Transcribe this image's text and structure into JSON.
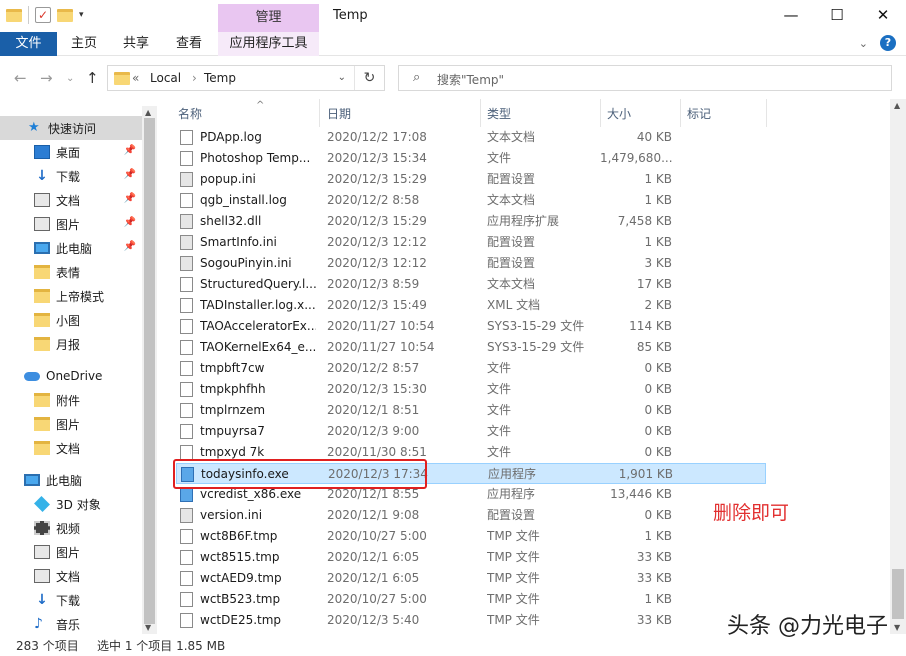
{
  "window": {
    "title": "Temp",
    "manage_tab": "管理",
    "controls": [
      "—",
      "☐",
      "✕"
    ]
  },
  "ribbon": {
    "tabs": [
      "文件",
      "主页",
      "共享",
      "查看",
      "应用程序工具"
    ]
  },
  "address": {
    "overflow": "«",
    "crumbs": [
      "Local",
      "Temp"
    ],
    "search_placeholder": "搜索\"Temp\""
  },
  "nav": {
    "items": [
      {
        "label": "快速访问",
        "icon": "star-icon"
      },
      {
        "label": "桌面",
        "icon": "desktop-icon"
      },
      {
        "label": "下载",
        "icon": "download-icon"
      },
      {
        "label": "文档",
        "icon": "document-icon"
      },
      {
        "label": "图片",
        "icon": "picture-icon"
      },
      {
        "label": "此电脑",
        "icon": "computer-icon"
      },
      {
        "label": "表情",
        "icon": "folder-icon"
      },
      {
        "label": "上帝模式",
        "icon": "folder-icon"
      },
      {
        "label": "小图",
        "icon": "folder-icon"
      },
      {
        "label": "月报",
        "icon": "folder-icon"
      },
      {
        "label": "OneDrive",
        "icon": "cloud-icon"
      },
      {
        "label": "附件",
        "icon": "folder-icon"
      },
      {
        "label": "图片",
        "icon": "folder-icon"
      },
      {
        "label": "文档",
        "icon": "folder-icon"
      },
      {
        "label": "此电脑",
        "icon": "computer-icon"
      },
      {
        "label": "3D 对象",
        "icon": "cube-icon"
      },
      {
        "label": "视频",
        "icon": "video-icon"
      },
      {
        "label": "图片",
        "icon": "picture-icon"
      },
      {
        "label": "文档",
        "icon": "document-icon"
      },
      {
        "label": "下载",
        "icon": "download-icon"
      },
      {
        "label": "音乐",
        "icon": "music-icon"
      }
    ]
  },
  "columns": [
    "名称",
    "日期",
    "类型",
    "大小",
    "标记"
  ],
  "files": [
    {
      "name": "PDApp.log",
      "date": "2020/12/2 17:08",
      "type": "文本文档",
      "size": "40 KB",
      "icon": "text-file-icon"
    },
    {
      "name": "Photoshop Temp...",
      "date": "2020/12/3 15:34",
      "type": "文件",
      "size": "1,479,680...",
      "icon": "file-icon"
    },
    {
      "name": "popup.ini",
      "date": "2020/12/3 15:29",
      "type": "配置设置",
      "size": "1 KB",
      "icon": "settings-file-icon"
    },
    {
      "name": "qgb_install.log",
      "date": "2020/12/2 8:58",
      "type": "文本文档",
      "size": "1 KB",
      "icon": "text-file-icon"
    },
    {
      "name": "shell32.dll",
      "date": "2020/12/3 15:29",
      "type": "应用程序扩展",
      "size": "7,458 KB",
      "icon": "dll-file-icon"
    },
    {
      "name": "SmartInfo.ini",
      "date": "2020/12/3 12:12",
      "type": "配置设置",
      "size": "1 KB",
      "icon": "settings-file-icon"
    },
    {
      "name": "SogouPinyin.ini",
      "date": "2020/12/3 12:12",
      "type": "配置设置",
      "size": "3 KB",
      "icon": "settings-file-icon"
    },
    {
      "name": "StructuredQuery.l...",
      "date": "2020/12/3 8:59",
      "type": "文本文档",
      "size": "17 KB",
      "icon": "text-file-icon"
    },
    {
      "name": "TADInstaller.log.x...",
      "date": "2020/12/3 15:49",
      "type": "XML 文档",
      "size": "2 KB",
      "icon": "xml-file-icon"
    },
    {
      "name": "TAOAcceleratorEx...",
      "date": "2020/11/27 10:54",
      "type": "SYS3-15-29 文件",
      "size": "114 KB",
      "icon": "file-icon"
    },
    {
      "name": "TAOKernelEx64_e...",
      "date": "2020/11/27 10:54",
      "type": "SYS3-15-29 文件",
      "size": "85 KB",
      "icon": "file-icon"
    },
    {
      "name": "tmpbft7cw",
      "date": "2020/12/2 8:57",
      "type": "文件",
      "size": "0 KB",
      "icon": "file-icon"
    },
    {
      "name": "tmpkphfhh",
      "date": "2020/12/3 15:30",
      "type": "文件",
      "size": "0 KB",
      "icon": "file-icon"
    },
    {
      "name": "tmplrnzem",
      "date": "2020/12/1 8:51",
      "type": "文件",
      "size": "0 KB",
      "icon": "file-icon"
    },
    {
      "name": "tmpuyrsa7",
      "date": "2020/12/3 9:00",
      "type": "文件",
      "size": "0 KB",
      "icon": "file-icon"
    },
    {
      "name": "tmpxyd 7k",
      "date": "2020/11/30 8:51",
      "type": "文件",
      "size": "0 KB",
      "icon": "file-icon"
    },
    {
      "name": "todaysinfo.exe",
      "date": "2020/12/3 17:34",
      "type": "应用程序",
      "size": "1,901 KB",
      "icon": "exe-file-icon",
      "selected": true
    },
    {
      "name": "vcredist_x86.exe",
      "date": "2020/12/1 8:55",
      "type": "应用程序",
      "size": "13,446 KB",
      "icon": "installer-icon"
    },
    {
      "name": "version.ini",
      "date": "2020/12/1 9:08",
      "type": "配置设置",
      "size": "0 KB",
      "icon": "settings-file-icon"
    },
    {
      "name": "wct8B6F.tmp",
      "date": "2020/10/27 5:00",
      "type": "TMP 文件",
      "size": "1 KB",
      "icon": "file-icon"
    },
    {
      "name": "wct8515.tmp",
      "date": "2020/12/1 6:05",
      "type": "TMP 文件",
      "size": "33 KB",
      "icon": "file-icon"
    },
    {
      "name": "wctAED9.tmp",
      "date": "2020/12/1 6:05",
      "type": "TMP 文件",
      "size": "33 KB",
      "icon": "file-icon"
    },
    {
      "name": "wctB523.tmp",
      "date": "2020/10/27 5:00",
      "type": "TMP 文件",
      "size": "1 KB",
      "icon": "file-icon"
    },
    {
      "name": "wctDE25.tmp",
      "date": "2020/12/3 5:40",
      "type": "TMP 文件",
      "size": "33 KB",
      "icon": "file-icon"
    }
  ],
  "annotation": "删除即可",
  "status": {
    "count": "283 个项目",
    "selection": "选中 1 个项目  1.85 MB"
  },
  "watermark": "头条 @力光电子",
  "colors": {
    "accent": "#1a5fa8",
    "selection": "#cce8ff",
    "highlight": "#e02020",
    "manage_tab": "#e9c6f1"
  }
}
